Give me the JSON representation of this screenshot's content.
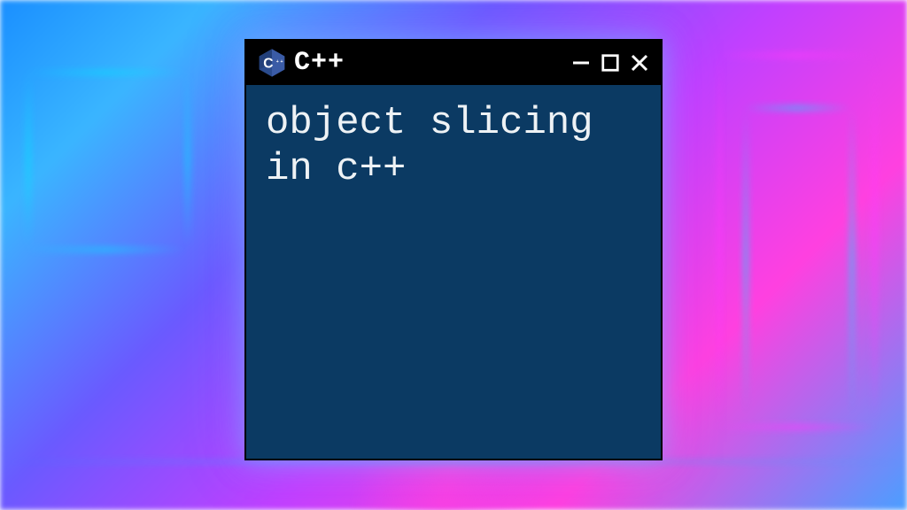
{
  "window": {
    "title": "C++",
    "icon": "cpp-logo-icon"
  },
  "content": {
    "text": "object slicing in c++"
  }
}
